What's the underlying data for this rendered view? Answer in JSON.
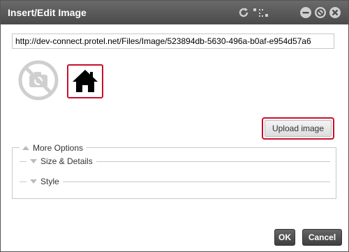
{
  "dialog": {
    "title": "Insert/Edit Image",
    "url_value": "http://dev-connect.protel.net/Files/Image/523894db-5630-496a-b0af-e954d57a6",
    "upload_label": "Upload image",
    "more_options_label": "More Options",
    "sections": [
      {
        "label": "Size & Details"
      },
      {
        "label": "Style"
      }
    ],
    "ok_label": "OK",
    "cancel_label": "Cancel"
  },
  "icons": {
    "titlebar": [
      "refresh-icon",
      "resize-icon",
      "minimize-icon",
      "close-icon",
      "circle-icon"
    ],
    "thumbnails": [
      "no-photo-icon",
      "home-icon"
    ]
  },
  "colors": {
    "titlebar": "#555555",
    "highlight": "#c8102e",
    "button": "#4a4a4a"
  }
}
